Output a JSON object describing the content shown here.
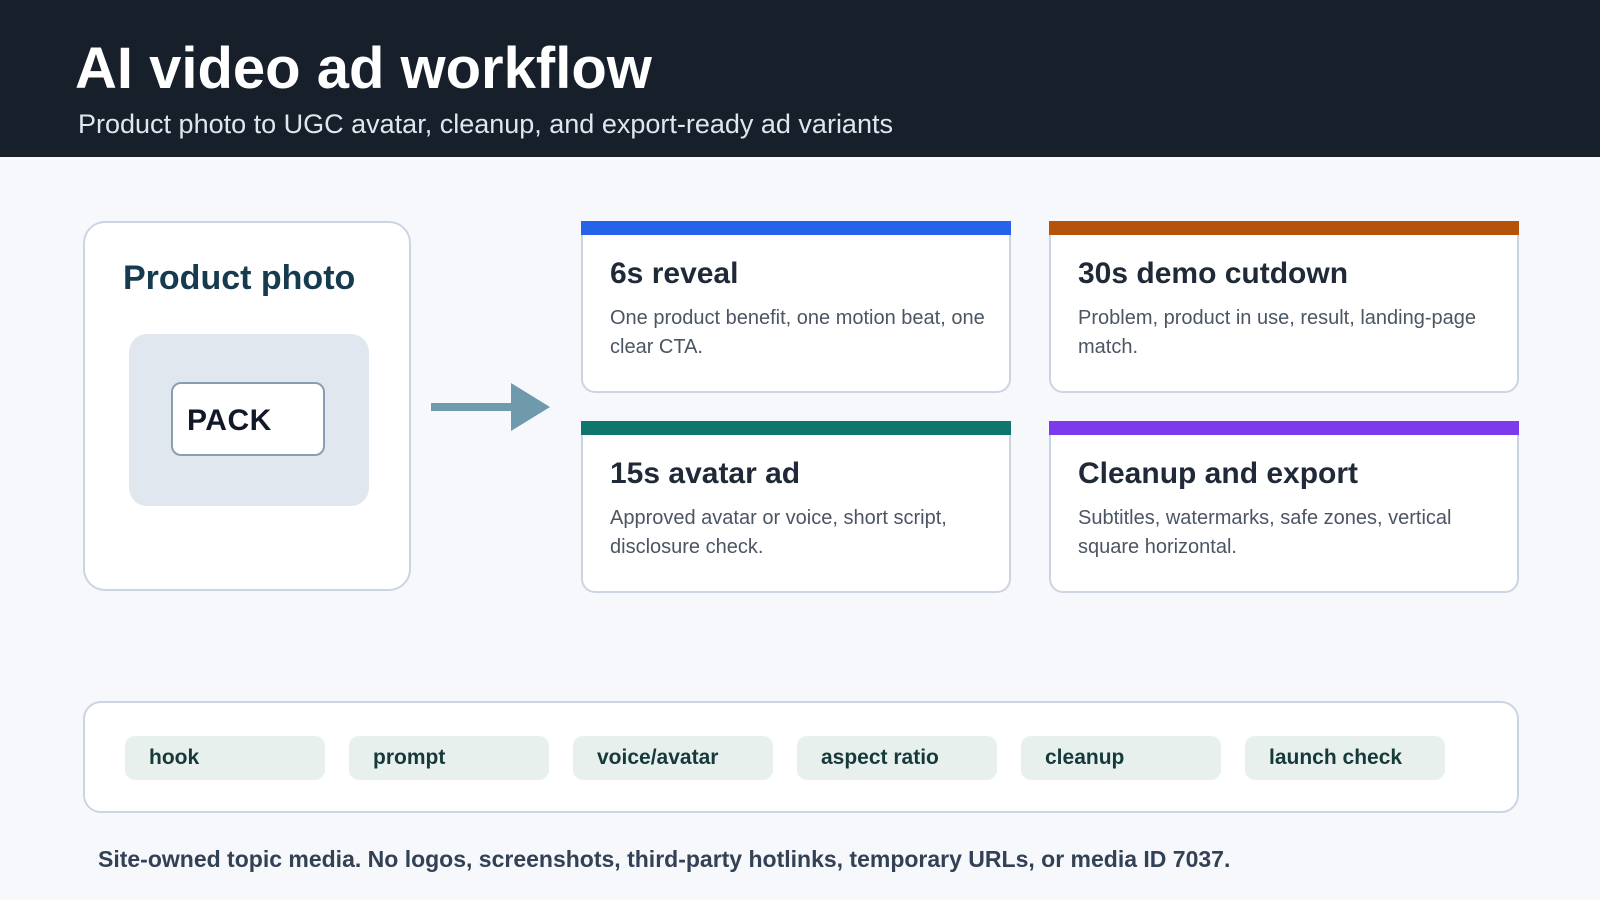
{
  "header": {
    "title": "AI video ad workflow",
    "subtitle": "Product photo to UGC avatar, cleanup, and export-ready ad variants"
  },
  "source": {
    "title": "Product photo",
    "pack_label": "PACK"
  },
  "flow_arrow": {
    "icon": "arrow-right-icon",
    "color": "#6f9aac"
  },
  "cards": [
    {
      "title": "6s reveal",
      "description": "One product benefit, one motion beat, one clear CTA.",
      "accent": "#2563eb"
    },
    {
      "title": "30s demo cutdown",
      "description": "Problem, product in use, result, landing-page match.",
      "accent": "#b45309"
    },
    {
      "title": "15s avatar ad",
      "description": "Approved avatar or voice, short script, disclosure check.",
      "accent": "#0f766e"
    },
    {
      "title": "Cleanup and export",
      "description": "Subtitles, watermarks, safe zones, vertical square horizontal.",
      "accent": "#7c3aed"
    }
  ],
  "tags": [
    "hook",
    "prompt",
    "voice/avatar",
    "aspect ratio",
    "cleanup",
    "launch check"
  ],
  "footer": {
    "note": "Site-owned topic media. No logos, screenshots, third-party hotlinks, temporary URLs, or media ID 7037."
  }
}
